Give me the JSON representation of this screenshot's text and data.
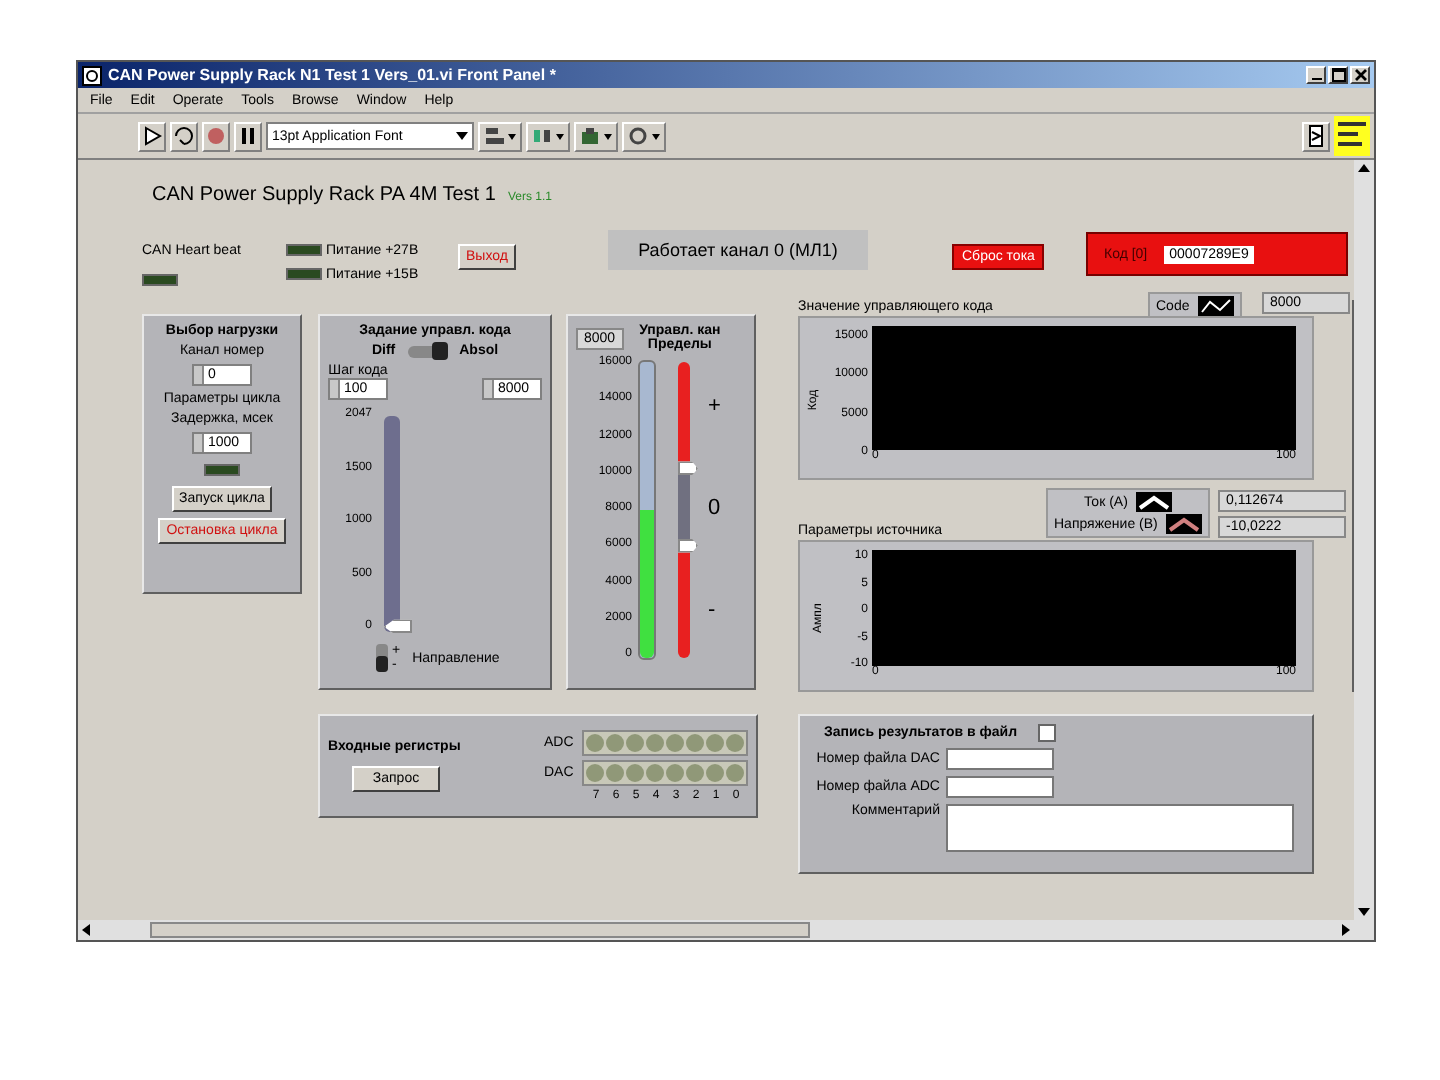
{
  "window": {
    "title": "CAN Power Supply Rack N1 Test 1 Vers_01.vi Front Panel *"
  },
  "menu": [
    "File",
    "Edit",
    "Operate",
    "Tools",
    "Browse",
    "Window",
    "Help"
  ],
  "toolbar": {
    "font": "13pt Application Font"
  },
  "panel": {
    "title": "CAN Power Supply Rack PA 4M Test 1",
    "version": "Vers 1.1"
  },
  "heartbeat": {
    "label": "CAN Heart beat",
    "on": false
  },
  "power": [
    {
      "label": "Питание +27В",
      "on": false
    },
    {
      "label": "Питание +15В",
      "on": false
    }
  ],
  "exit_button": "Выход",
  "status": "Работает канал 0 (МЛ1)",
  "reset_button": "Сброс тока",
  "code_display": {
    "label": "Код [0]",
    "value": "00007289E9"
  },
  "load_panel": {
    "title": "Выбор нагрузки",
    "channel_label": "Канал номер",
    "channel": "0",
    "cycle_title": "Параметры цикла",
    "delay_label": "Задержка, мсек",
    "delay": "1000",
    "led_on": false,
    "start_button": "Запуск цикла",
    "stop_button": "Остановка цикла"
  },
  "code_panel": {
    "title": "Задание управл. кода",
    "mode_left": "Diff",
    "mode_right": "Absol",
    "absolute": true,
    "step_label": "Шаг кода",
    "step": "100",
    "abs_value": "8000",
    "slider_ticks": [
      "2047",
      "1500",
      "1000",
      "500",
      "0"
    ],
    "level": 0.02,
    "direction_up": false,
    "plus": "+",
    "minus": "-",
    "direction_label": "Направление"
  },
  "channel_panel": {
    "title": "Управл. кан",
    "limits_title": "Пределы",
    "value": "8000",
    "scale": [
      "16000",
      "14000",
      "12000",
      "10000",
      "8000",
      "6000",
      "4000",
      "2000",
      "0"
    ],
    "level": 0.5,
    "upper_limit": {
      "level": 0.64
    },
    "lower_limit": {
      "level": 0.38
    },
    "plus": "+",
    "zero": "0",
    "minus": "-"
  },
  "chart_code": {
    "title": "Значение управляющего кода",
    "legend": "Code",
    "readout": "8000",
    "y_label": "Код",
    "y_ticks": [
      "15000",
      "10000",
      "5000",
      "0"
    ],
    "x_ticks": [
      "0",
      "100"
    ]
  },
  "chart_source": {
    "title": "Параметры источника",
    "legend": [
      {
        "name": "Ток (А)",
        "color": "#ffffff"
      },
      {
        "name": "Напряжение (В)",
        "color": "#d08080"
      }
    ],
    "readouts": [
      "0,112674",
      "-10,0222"
    ],
    "y_label": "Ампл",
    "y_ticks": [
      "10",
      "5",
      "0",
      "-5",
      "-10"
    ],
    "x_ticks": [
      "0",
      "100"
    ]
  },
  "registers": {
    "title": "Входные регистры",
    "button": "Запрос",
    "rows": [
      {
        "label": "ADC",
        "bits": [
          false,
          false,
          false,
          false,
          false,
          false,
          false,
          false
        ]
      },
      {
        "label": "DAC",
        "bits": [
          false,
          false,
          false,
          false,
          false,
          false,
          false,
          false
        ]
      }
    ],
    "bit_labels": [
      "7",
      "6",
      "5",
      "4",
      "3",
      "2",
      "1",
      "0"
    ]
  },
  "file": {
    "title": "Запись результатов в файл",
    "checked": false,
    "fields": [
      {
        "label": "Номер файла DAC"
      },
      {
        "label": "Номер файла ADC"
      }
    ],
    "comment_label": "Комментарий"
  }
}
